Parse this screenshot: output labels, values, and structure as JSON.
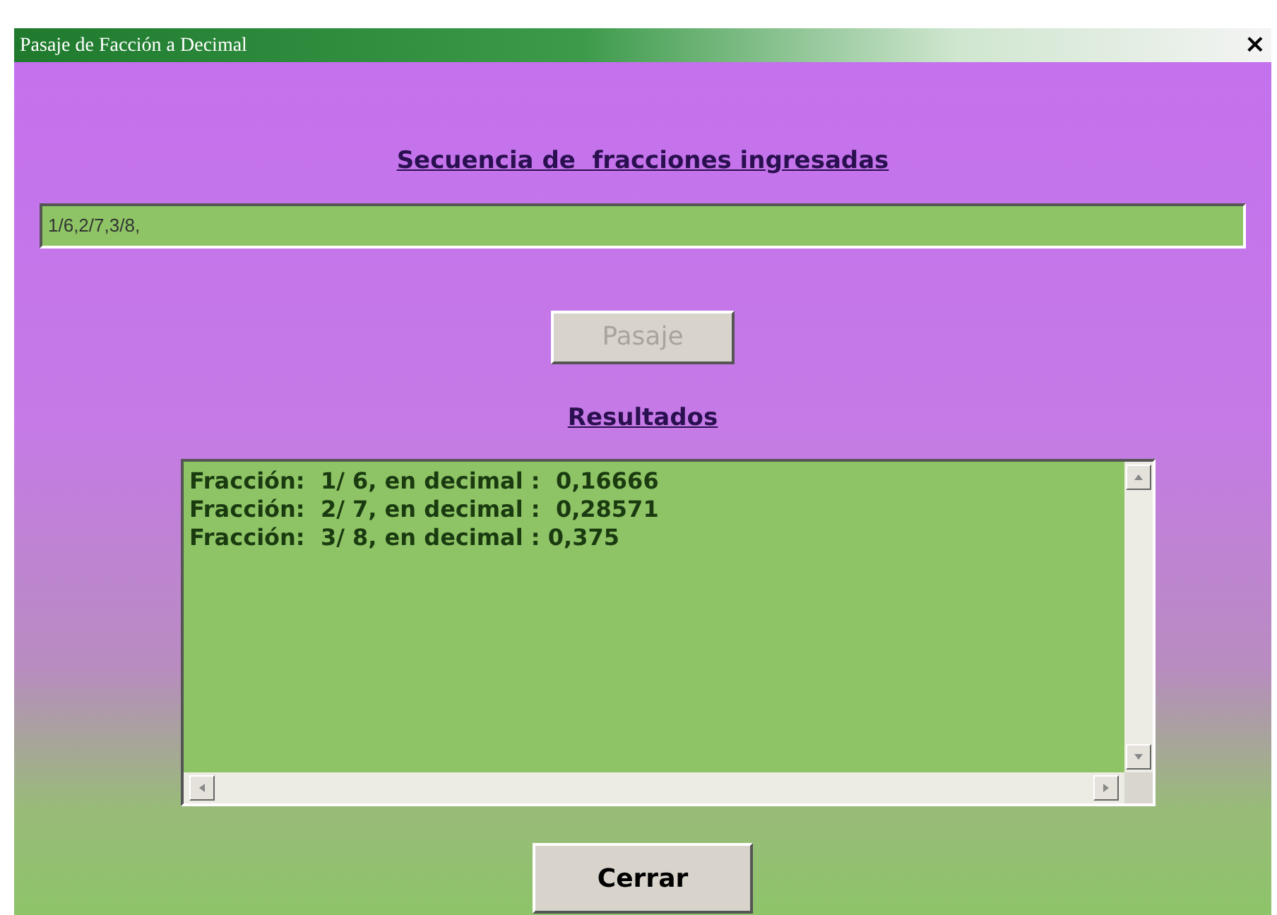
{
  "window": {
    "title": "Pasaje de Facción a Decimal",
    "close": "×"
  },
  "heading": "Secuencia de  fracciones ingresadas",
  "input": {
    "value": "1/6,2/7,3/8,"
  },
  "convert_button": {
    "label": "Pasaje",
    "disabled": true
  },
  "results_heading": "Resultados",
  "results": [
    "Fracción:  1/ 6, en decimal :  0,16666",
    "Fracción:  2/ 7, en decimal :  0,28571",
    "Fracción:  3/ 8, en decimal : 0,375"
  ],
  "close_button": {
    "label": "Cerrar",
    "disabled": false
  }
}
